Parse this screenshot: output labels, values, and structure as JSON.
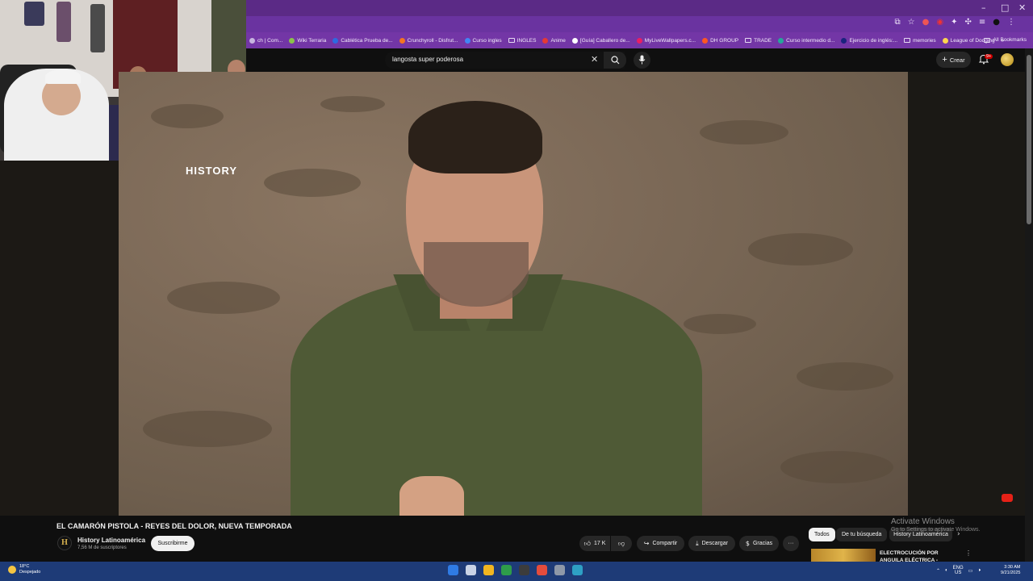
{
  "window": {
    "minimize": "–",
    "maximize": "□",
    "close": "✕"
  },
  "bookmarks": [
    {
      "label": "ch | Com...",
      "color": "#c7b5e0",
      "type": "site"
    },
    {
      "label": "Wiki Terraria",
      "color": "#8bc34a",
      "type": "site"
    },
    {
      "label": "Cablética Prueba de...",
      "color": "#2d6ae0",
      "type": "site"
    },
    {
      "label": "Crunchyroll - Disfrut...",
      "color": "#f47521",
      "type": "site"
    },
    {
      "label": "Curso ingles",
      "color": "#4285f4",
      "type": "site"
    },
    {
      "label": "INGLES",
      "color": "",
      "type": "folder"
    },
    {
      "label": "Anime",
      "color": "#e53935",
      "type": "site"
    },
    {
      "label": "[Guía] Caballero de...",
      "color": "#ffffff",
      "type": "site"
    },
    {
      "label": "MyLiveWallpapers.c...",
      "color": "#e91e63",
      "type": "site"
    },
    {
      "label": "DH GROUP",
      "color": "#ff5722",
      "type": "site"
    },
    {
      "label": "TRADE",
      "color": "",
      "type": "folder"
    },
    {
      "label": "Curso intermedio d...",
      "color": "#26a69a",
      "type": "site"
    },
    {
      "label": "Ejercicio de inglés:...",
      "color": "#1a237e",
      "type": "site"
    },
    {
      "label": "memories",
      "color": "",
      "type": "folder"
    },
    {
      "label": "League of Dodging",
      "color": "#ffd54f",
      "type": "site"
    }
  ],
  "bookmarks_more": "»",
  "all_bookmarks": "All Bookmarks",
  "search": {
    "query": "langosta super poderosa",
    "clear_icon": "✕"
  },
  "header": {
    "create_label": "Crear",
    "notif_count": "9+"
  },
  "video": {
    "channel_watermark": "HISTORY"
  },
  "info": {
    "title": "EL CAMARÓN PISTOLA - REYES DEL DOLOR, NUEVA TEMPORADA",
    "channel": "History Latinoamérica",
    "channel_initial": "H",
    "subscribers": "7,56 M de suscriptores",
    "subscribe": "Suscribirme",
    "likes": "17 K",
    "share": "Compartir",
    "download": "Descargar",
    "thanks": "Gracias",
    "more": "···"
  },
  "chips": [
    "Todos",
    "De tu búsqueda",
    "History Latinoamérica"
  ],
  "recommendation": {
    "title": "ELECTROCUCIÓN POR ANGUILA ELÉCTRICA - REYES...",
    "more": "⋮"
  },
  "watermark": {
    "line1": "Activate Windows",
    "line2": "Go to Settings to activate Windows."
  },
  "taskbar": {
    "temp": "18°C",
    "weather": "Despejado",
    "lang": "ENG",
    "region": "US",
    "time": "3:30 AM",
    "date": "9/21/2025",
    "apps": [
      "#2f7be5",
      "#c9d3e6",
      "#f2b620",
      "#2e9d4a",
      "#3c3c3c",
      "#e54c3c",
      "#8e98a8",
      "#2ea0c4"
    ]
  }
}
